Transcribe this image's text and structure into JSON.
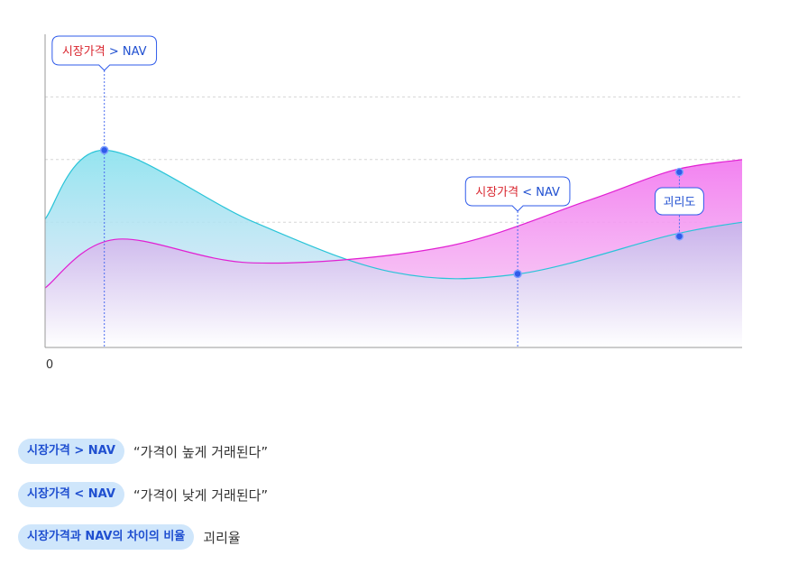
{
  "chart_data": {
    "type": "area",
    "origin_label": "0",
    "series": [
      {
        "color_line": "#29c4d8",
        "color_fill_top": "#8fe3ef",
        "points": [
          [
            0,
            0.41
          ],
          [
            0.085,
            0.63
          ],
          [
            0.3,
            0.4
          ],
          [
            0.5,
            0.24
          ],
          [
            0.68,
            0.235
          ],
          [
            0.9,
            0.36
          ],
          [
            1.0,
            0.4
          ]
        ]
      },
      {
        "color_line": "#e11fd2",
        "color_fill_top": "#f27cf0",
        "points": [
          [
            0,
            0.19
          ],
          [
            0.1,
            0.345
          ],
          [
            0.3,
            0.27
          ],
          [
            0.57,
            0.32
          ],
          [
            0.78,
            0.47
          ],
          [
            0.9,
            0.565
          ],
          [
            1.0,
            0.6
          ]
        ]
      }
    ],
    "markers": [
      {
        "x": 0.085,
        "y": 0.63
      },
      {
        "x": 0.678,
        "y": 0.235
      },
      {
        "x": 0.91,
        "y": 0.56
      },
      {
        "x": 0.91,
        "y": 0.355
      }
    ],
    "callouts": [
      {
        "red": "시장가격",
        "sym": " > ",
        "blue": "NAV",
        "x": 0.085
      },
      {
        "red": "시장가격",
        "sym": " < ",
        "blue": "NAV",
        "x": 0.678
      },
      {
        "blue": "괴리도",
        "x": 0.91
      }
    ]
  },
  "legend": [
    {
      "pill": "시장가격 > NAV",
      "text": "“가격이 높게 거래된다”"
    },
    {
      "pill": "시장가격 < NAV",
      "text": "“가격이 낮게 거래된다”"
    },
    {
      "pill": "시장가격과 NAV의 차이의 비율",
      "text": "괴리율"
    }
  ]
}
